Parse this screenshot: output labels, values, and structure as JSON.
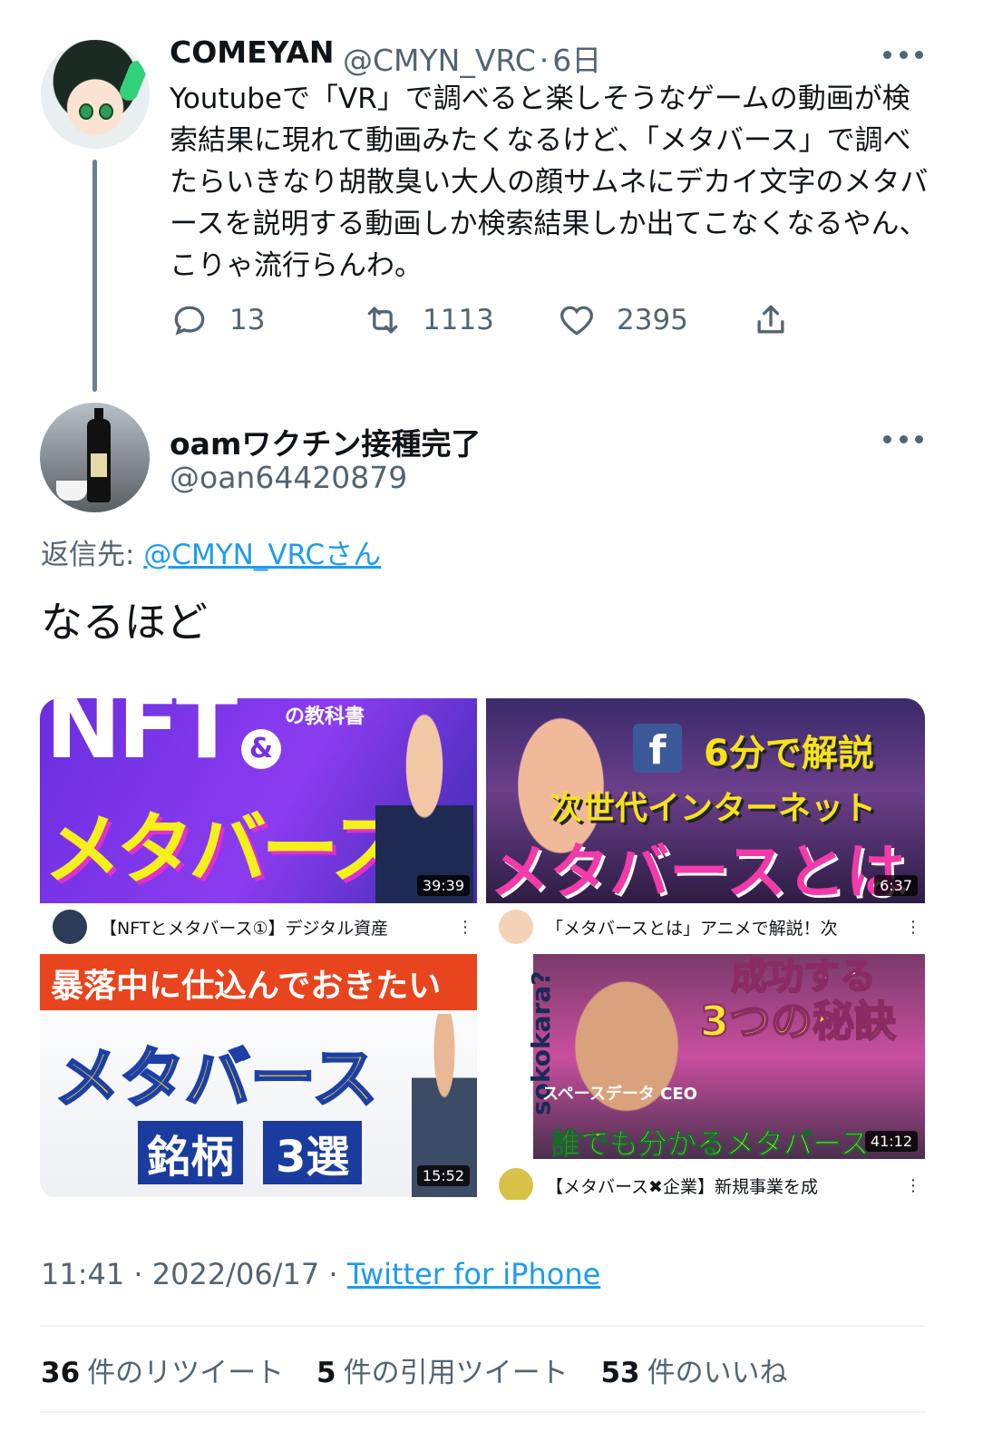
{
  "parent": {
    "display_name": "COMEYAN",
    "handle": "@CMYN_VRC",
    "time": "6日",
    "body": "Youtubeで「VR」で調べると楽しそうなゲームの動画が検索結果に現れて動画みたくなるけど、「メタバース」で調べたらいきなり胡散臭い大人の顔サムネにデカイ文字のメタバースを説明する動画しか検索結果しか出てこなくなるやん、こりゃ流行らんわ。",
    "reply_count": "13",
    "retweet_count": "1113",
    "like_count": "2395"
  },
  "reply": {
    "display_name": "oamワクチン接種完了",
    "handle": "@oan64420879",
    "reply_to_prefix": "返信先:",
    "reply_to_user": "@CMYN_VRCさん",
    "body": "なるほど"
  },
  "media": [
    {
      "title": "【NFTとメタバース①】デジタル資産",
      "duration": "39:39",
      "thumb_text_1": "NFT",
      "thumb_text_2": "メタバース",
      "thumb_text_3": "の教科書"
    },
    {
      "title": "「メタバースとは」アニメで解説！次",
      "duration": "6:37",
      "thumb_text_1": "6分で解説",
      "thumb_text_2": "次世代インターネット",
      "thumb_text_3": "メタバースとは"
    },
    {
      "title": "",
      "duration": "15:52",
      "thumb_text_1": "暴落中に仕込んでおきたい",
      "thumb_text_2": "メタバース",
      "thumb_text_3": "銘柄",
      "thumb_text_4": "3選"
    },
    {
      "title": "【メタバース✖企業】新規事業を成",
      "duration": "41:12",
      "thumb_text_1": "成功する",
      "thumb_text_2": "3つの秘訣",
      "thumb_text_3": "誰でも分かるメタバース",
      "thumb_text_4": "sokokara?",
      "thumb_text_5": "スペースデータ CEO"
    }
  ],
  "meta": {
    "time": "11:41",
    "date": "2022/06/17",
    "separator": "·",
    "source": "Twitter for iPhone"
  },
  "stats": {
    "retweets_count": "36",
    "retweets_label": "件のリツイート",
    "quotes_count": "5",
    "quotes_label": "件の引用ツイート",
    "likes_count": "53",
    "likes_label": "件のいいね"
  },
  "colors": {
    "link": "#1d9bf0",
    "muted": "#536471",
    "text": "#0f1419"
  }
}
